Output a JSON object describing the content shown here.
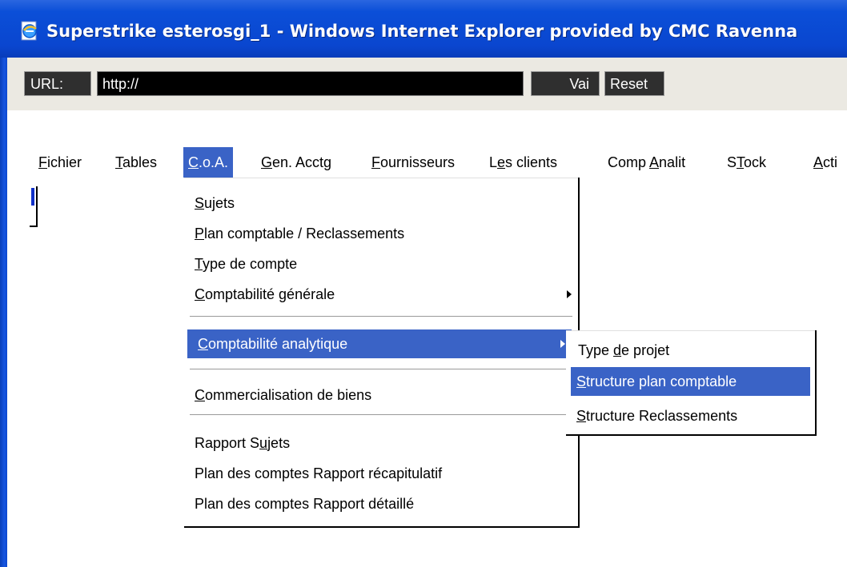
{
  "window": {
    "title": "Superstrike esterosgi_1 - Windows Internet Explorer provided by CMC Ravenna",
    "icon": "ie-page-icon"
  },
  "toolbar": {
    "url_label": "URL:",
    "url_value": "http://",
    "go_label": "Vai",
    "reset_label": "Reset"
  },
  "menubar": {
    "items": [
      {
        "label": "Fichier",
        "hotkey": "F"
      },
      {
        "label": "Tables",
        "hotkey": "T"
      },
      {
        "label": "C.o.A.",
        "hotkey": "C",
        "active": true
      },
      {
        "label": "Gen. Acctg",
        "hotkey": "G"
      },
      {
        "label": "Fournisseurs",
        "hotkey": "F"
      },
      {
        "label": "Les clients",
        "hotkey": "e"
      },
      {
        "label": "Comp Analit",
        "hotkey": "A"
      },
      {
        "label": "STock",
        "hotkey": "T"
      },
      {
        "label": "Acti",
        "hotkey": "A"
      }
    ]
  },
  "coa_menu": {
    "items": [
      {
        "label": "Sujets",
        "hotkey": "S"
      },
      {
        "label": "Plan comptable / Reclassements",
        "hotkey": "P"
      },
      {
        "label": "Type de compte",
        "hotkey": "T"
      },
      {
        "label": "Comptabilité générale",
        "hotkey": "C",
        "submenu": true
      },
      {
        "label": "Comptabilité analytique",
        "hotkey": "C",
        "submenu": true,
        "highlighted": true
      },
      {
        "label": "Commercialisation de biens",
        "hotkey": "C",
        "submenu": true
      },
      {
        "label": "Rapport Sujets",
        "hotkey": "u"
      },
      {
        "label": "Plan des comptes Rapport récapitulatif",
        "hotkey": ""
      },
      {
        "label": "Plan des comptes Rapport détaillé",
        "hotkey": ""
      }
    ]
  },
  "analytic_submenu": {
    "items": [
      {
        "label": "Type de projet",
        "hotkey": "d"
      },
      {
        "label": "Structure plan comptable",
        "hotkey": "S",
        "highlighted": true
      },
      {
        "label": "Structure Reclassements",
        "hotkey": "S"
      }
    ]
  },
  "colors": {
    "titlebar": "#0b4fd8",
    "menu_highlight": "#3a63c6",
    "toolbar_bg": "#ebe9e2"
  }
}
